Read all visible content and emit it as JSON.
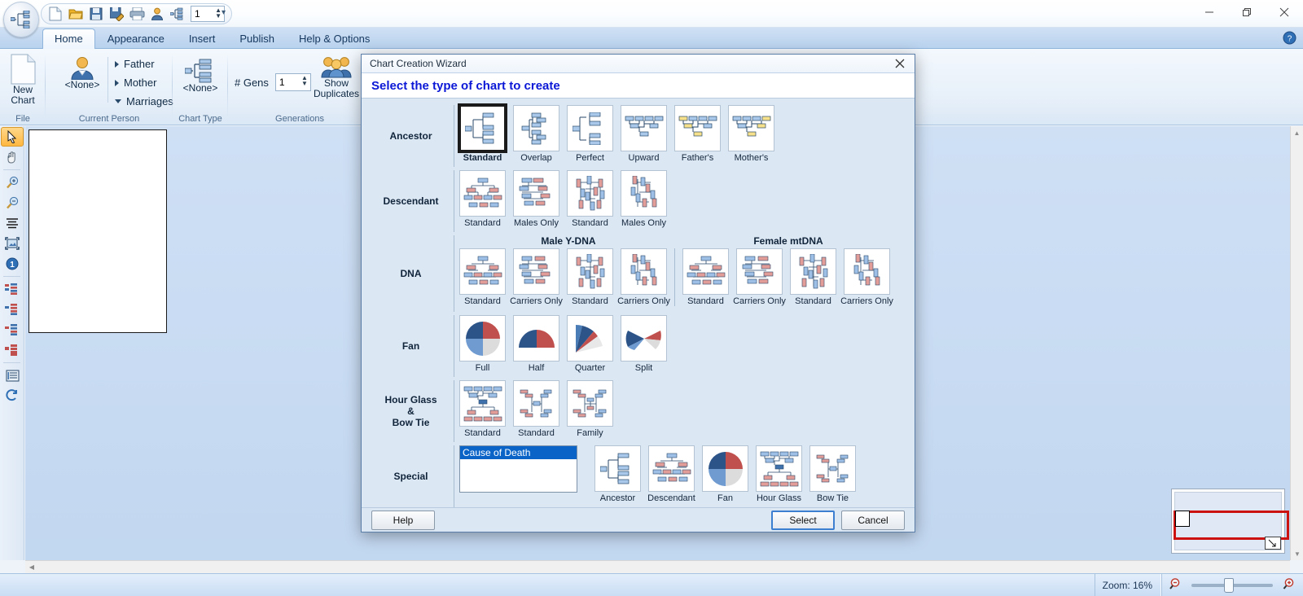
{
  "window": {
    "controls": {
      "minimize": "minimize-icon",
      "restore": "restore-icon",
      "close": "close-icon"
    }
  },
  "quick_access": {
    "items": [
      {
        "name": "new-icon",
        "label": "New"
      },
      {
        "name": "open-folder-icon",
        "label": "Open"
      },
      {
        "name": "save-icon",
        "label": "Save"
      },
      {
        "name": "save-as-icon",
        "label": "Save As"
      },
      {
        "name": "print-icon",
        "label": "Print"
      },
      {
        "name": "person-icon",
        "label": "Person"
      },
      {
        "name": "chart-tree-icon",
        "label": "Chart"
      }
    ],
    "spinner_value": "1",
    "overflow_label": "▾"
  },
  "ribbon": {
    "tabs": [
      {
        "label": "Home",
        "active": true
      },
      {
        "label": "Appearance",
        "active": false
      },
      {
        "label": "Insert",
        "active": false
      },
      {
        "label": "Publish",
        "active": false
      },
      {
        "label": "Help & Options",
        "active": false
      }
    ],
    "help_icon": "help-circle-icon",
    "groups": [
      {
        "name": "file",
        "label": "File",
        "buttons": [
          {
            "label_line1": "New",
            "label_line2": "Chart",
            "icon": "new-chart-icon"
          }
        ]
      },
      {
        "name": "current-person",
        "label": "Current Person",
        "buttons": [
          {
            "label_line1": "<None>",
            "icon": "person-icon"
          }
        ],
        "menu": [
          "Father",
          "Mother",
          "Marriages"
        ]
      },
      {
        "name": "chart-type",
        "label": "Chart Type",
        "buttons": [
          {
            "label_line1": "<None>",
            "icon": "chart-tree-icon"
          }
        ]
      },
      {
        "name": "generations",
        "label": "Generations",
        "gens_label": "# Gens",
        "gens_value": "1",
        "buttons": [
          {
            "label_line1": "Show",
            "label_line2": "Duplicates",
            "icon": "duplicates-icon"
          }
        ]
      }
    ]
  },
  "tool_rail": [
    {
      "name": "select-arrow-icon",
      "selected": true
    },
    {
      "name": "hand-pan-icon",
      "selected": false
    },
    {
      "name": "zoom-in-icon",
      "selected": false
    },
    {
      "name": "zoom-out-icon",
      "selected": false
    },
    {
      "name": "align-text-icon",
      "selected": false
    },
    {
      "name": "fit-image-icon",
      "selected": false
    },
    {
      "name": "number-one-icon",
      "selected": false
    },
    {
      "name": "tree-blue-red-icon",
      "selected": false
    },
    {
      "name": "tree-red-icon",
      "selected": false
    },
    {
      "name": "tree-blue-icon",
      "selected": false
    },
    {
      "name": "tree-red-solid-icon",
      "selected": false
    },
    {
      "name": "list-panel-icon",
      "selected": false
    },
    {
      "name": "refresh-icon",
      "selected": false
    }
  ],
  "dialog": {
    "title": "Chart Creation Wizard",
    "close_icon": "close-icon",
    "heading": "Select the type of chart to create",
    "rows": [
      {
        "label": "Ancestor",
        "items": [
          {
            "caption": "Standard",
            "selected": true,
            "icon": "ancestor-standard-icon"
          },
          {
            "caption": "Overlap",
            "selected": false,
            "icon": "ancestor-overlap-icon"
          },
          {
            "caption": "Perfect",
            "selected": false,
            "icon": "ancestor-perfect-icon"
          },
          {
            "caption": "Upward",
            "selected": false,
            "icon": "ancestor-upward-icon"
          },
          {
            "caption": "Father's",
            "selected": false,
            "icon": "ancestor-fathers-icon"
          },
          {
            "caption": "Mother's",
            "selected": false,
            "icon": "ancestor-mothers-icon"
          }
        ]
      },
      {
        "label": "Descendant",
        "items": [
          {
            "caption": "Standard",
            "selected": false,
            "icon": "descendant-standard-icon"
          },
          {
            "caption": "Males Only",
            "selected": false,
            "icon": "descendant-males-only-icon"
          },
          {
            "caption": "Standard",
            "selected": false,
            "icon": "descendant-standard-vertical-icon"
          },
          {
            "caption": "Males Only",
            "selected": false,
            "icon": "descendant-males-only-vertical-icon"
          }
        ]
      },
      {
        "label": "DNA",
        "subheads": [
          "Male Y-DNA",
          "Female mtDNA"
        ],
        "items": [
          {
            "caption": "Standard",
            "selected": false,
            "icon": "dna-y-standard-icon"
          },
          {
            "caption": "Carriers Only",
            "selected": false,
            "icon": "dna-y-carriers-icon"
          },
          {
            "caption": "Standard",
            "selected": false,
            "icon": "dna-y-standard-vertical-icon"
          },
          {
            "caption": "Carriers Only",
            "selected": false,
            "icon": "dna-y-carriers-vertical-icon"
          },
          {
            "caption": "Standard",
            "selected": false,
            "icon": "dna-mt-standard-icon"
          },
          {
            "caption": "Carriers Only",
            "selected": false,
            "icon": "dna-mt-carriers-icon"
          },
          {
            "caption": "Standard",
            "selected": false,
            "icon": "dna-mt-standard-vertical-icon"
          },
          {
            "caption": "Carriers Only",
            "selected": false,
            "icon": "dna-mt-carriers-vertical-icon"
          }
        ]
      },
      {
        "label": "Fan",
        "items": [
          {
            "caption": "Full",
            "selected": false,
            "icon": "fan-full-icon"
          },
          {
            "caption": "Half",
            "selected": false,
            "icon": "fan-half-icon"
          },
          {
            "caption": "Quarter",
            "selected": false,
            "icon": "fan-quarter-icon"
          },
          {
            "caption": "Split",
            "selected": false,
            "icon": "fan-split-icon"
          }
        ]
      },
      {
        "label": "Hour Glass\n&\nBow Tie",
        "label_lines": [
          "Hour Glass",
          "&",
          "Bow Tie"
        ],
        "items": [
          {
            "caption": "Standard",
            "selected": false,
            "icon": "hourglass-standard-icon"
          },
          {
            "caption": "Standard",
            "selected": false,
            "icon": "bowtie-standard-icon"
          },
          {
            "caption": "Family",
            "selected": false,
            "icon": "bowtie-family-icon"
          }
        ]
      },
      {
        "label": "Special",
        "list_options": [
          {
            "label": "Cause of Death",
            "selected": true
          }
        ],
        "items": [
          {
            "caption": "Ancestor",
            "selected": false,
            "icon": "special-ancestor-icon"
          },
          {
            "caption": "Descendant",
            "selected": false,
            "icon": "special-descendant-icon"
          },
          {
            "caption": "Fan",
            "selected": false,
            "icon": "special-fan-icon"
          },
          {
            "caption": "Hour Glass",
            "selected": false,
            "icon": "special-hourglass-icon"
          },
          {
            "caption": "Bow Tie",
            "selected": false,
            "icon": "special-bowtie-icon"
          }
        ]
      }
    ],
    "buttons": {
      "help": "Help",
      "select": "Select",
      "cancel": "Cancel"
    }
  },
  "status_bar": {
    "zoom_label": "Zoom: 16%",
    "zoom_out_icon": "zoom-out-icon",
    "zoom_in_icon": "zoom-in-icon",
    "zoom_percent": 16
  },
  "colors": {
    "accent_blue": "#2c5488",
    "light_blue": "#6f9bd1",
    "red": "#c0504d",
    "heading_blue": "#0b18d6",
    "selection_blue": "#0a64c8",
    "minimap_red": "#cc1111"
  }
}
